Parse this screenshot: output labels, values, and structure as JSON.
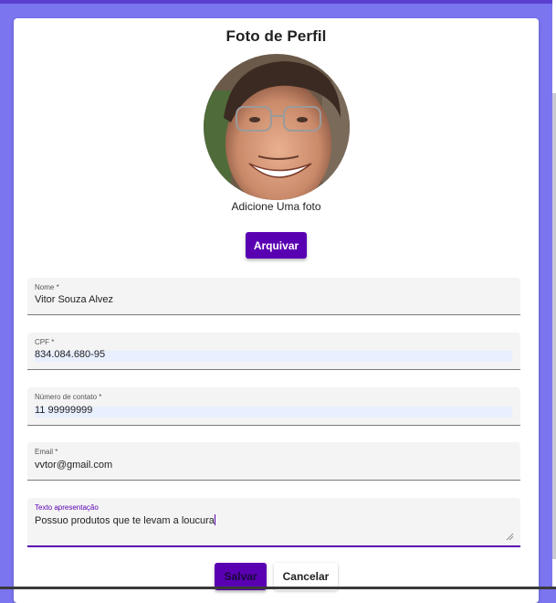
{
  "profile": {
    "title": "Foto de Perfil",
    "avatar_caption": "Adicione Uma foto",
    "upload_label": "Arquivar"
  },
  "form": {
    "nome": {
      "label": "Nome *",
      "value": "Vitor Souza Alvez"
    },
    "cpf": {
      "label": "CPF *",
      "value": "834.084.680-95"
    },
    "contato": {
      "label": "Número de contato *",
      "value": "11 99999999"
    },
    "email": {
      "label": "Email *",
      "value": "vvtor@gmail.com"
    },
    "apresentacao": {
      "label": "Texto apresentação",
      "value": "Possuo produtos que te levam a loucura"
    }
  },
  "actions": {
    "save_label": "Salvar",
    "cancel_label": "Cancelar"
  },
  "colors": {
    "accent": "#5a00b3",
    "page_background": "#7b75f0",
    "autofill": "#e8efff"
  },
  "icons": {
    "textarea_resize": "resize-grip-icon"
  }
}
